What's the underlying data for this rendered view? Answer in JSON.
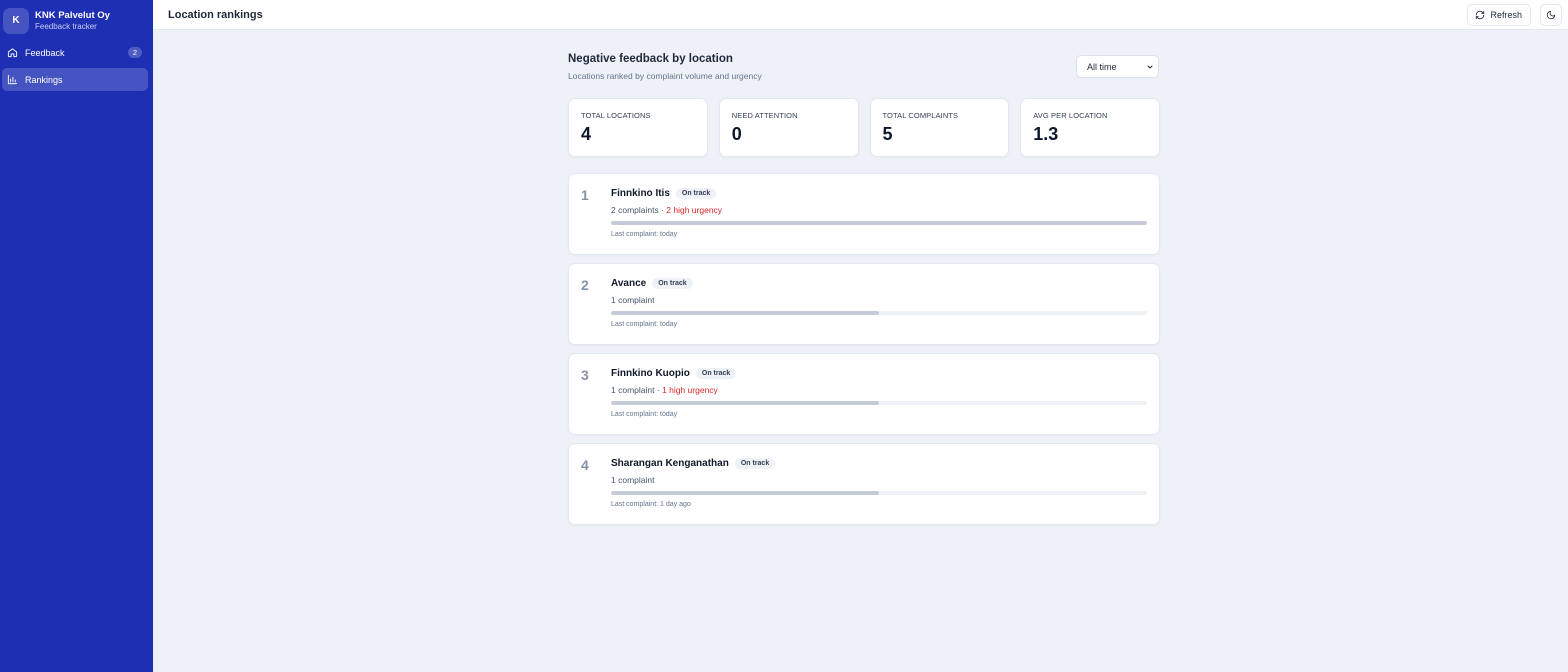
{
  "brand": {
    "initial": "K",
    "name": "KNK Palvelut Oy",
    "subtitle": "Feedback tracker"
  },
  "nav": [
    {
      "label": "Feedback",
      "icon": "home-icon",
      "badge": "2",
      "active": false
    },
    {
      "label": "Rankings",
      "icon": "bar-chart-icon",
      "badge": "",
      "active": true
    }
  ],
  "topbar": {
    "title": "Location rankings",
    "refresh_label": "Refresh",
    "theme_icon": "moon-icon"
  },
  "header": {
    "title": "Negative feedback by location",
    "subtitle": "Locations ranked by complaint volume and urgency",
    "period": "All time"
  },
  "stats": [
    {
      "label": "TOTAL LOCATIONS",
      "value": "4"
    },
    {
      "label": "NEED ATTENTION",
      "value": "0"
    },
    {
      "label": "TOTAL COMPLAINTS",
      "value": "5"
    },
    {
      "label": "AVG PER LOCATION",
      "value": "1.3"
    }
  ],
  "rankings": [
    {
      "rank": "1",
      "name": "Finnkino Itis",
      "status": "On track",
      "complaints": "2 complaints",
      "urgency": "2 high urgency",
      "last": "Last complaint: today",
      "level": 1.0
    },
    {
      "rank": "2",
      "name": "Avance",
      "status": "On track",
      "complaints": "1 complaint",
      "urgency": "",
      "last": "Last complaint: today",
      "level": 0.5
    },
    {
      "rank": "3",
      "name": "Finnkino Kuopio",
      "status": "On track",
      "complaints": "1 complaint",
      "urgency": "1 high urgency",
      "last": "Last complaint: today",
      "level": 0.5
    },
    {
      "rank": "4",
      "name": "Sharangan Kenganathan",
      "status": "On track",
      "complaints": "1 complaint",
      "urgency": "",
      "last": "Last complaint: 1 day ago",
      "level": 0.5
    }
  ],
  "colors": {
    "sidebar": "#1e2fb4",
    "urgent": "#dc2626",
    "background": "#eef2f8"
  }
}
